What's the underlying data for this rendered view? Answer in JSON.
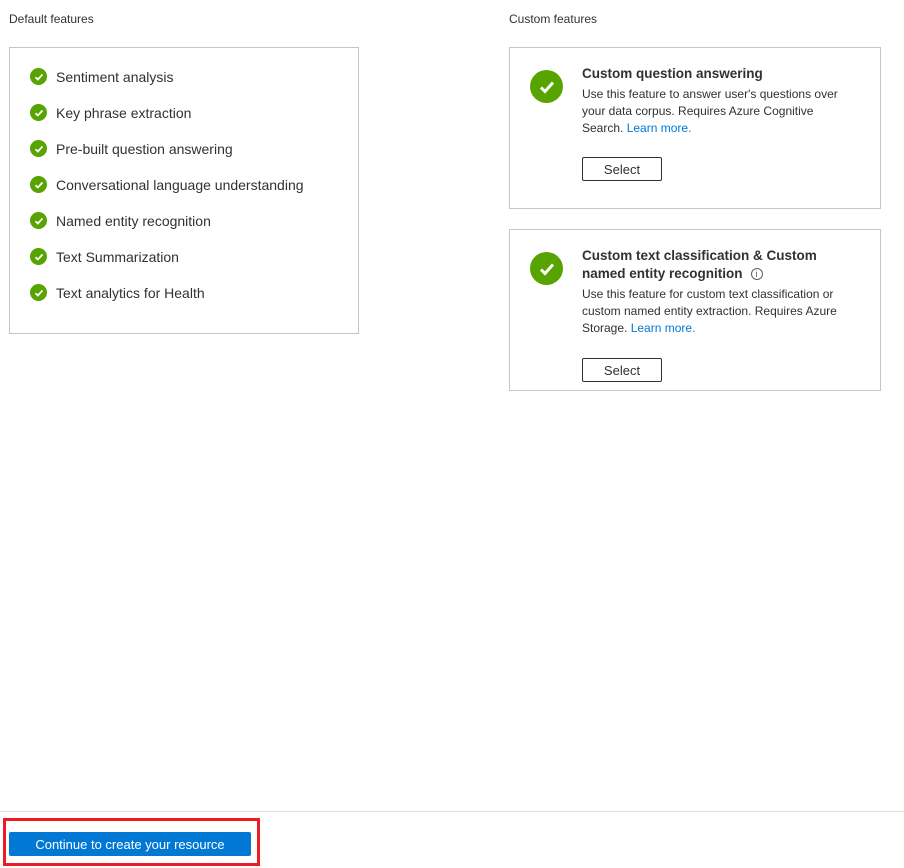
{
  "default_features": {
    "title": "Default features",
    "items": [
      "Sentiment analysis",
      "Key phrase extraction",
      "Pre-built question answering",
      "Conversational language understanding",
      "Named entity recognition",
      "Text Summarization",
      "Text analytics for Health"
    ]
  },
  "custom_features": {
    "title": "Custom features",
    "cards": [
      {
        "title": "Custom question answering",
        "description": "Use this feature to answer user's questions over your data corpus. Requires Azure Cognitive Search. ",
        "link": "Learn more.",
        "button": "Select"
      },
      {
        "title": "Custom text classification & Custom named entity recognition",
        "info_icon": "i",
        "description": "Use this feature for custom text classification or custom named entity extraction. Requires Azure Storage. ",
        "link": "Learn more.",
        "button": "Select"
      }
    ]
  },
  "footer": {
    "continue_label": "Continue to create your resource"
  },
  "colors": {
    "check": "#57a300",
    "link": "#0078d4",
    "primary": "#0078d4",
    "highlight": "#ed1c24"
  }
}
